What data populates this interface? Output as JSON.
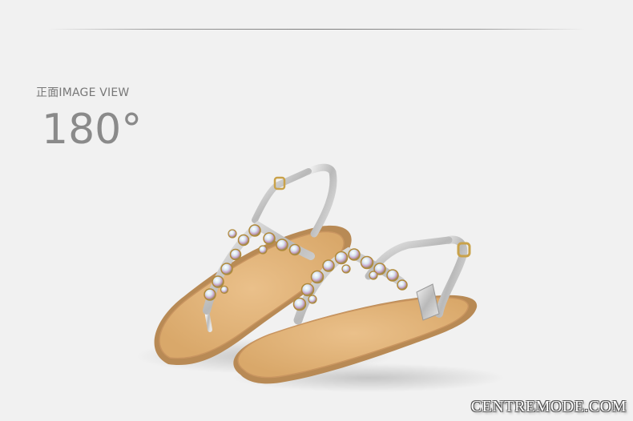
{
  "header": {
    "view_label": "正面IMAGE VIEW",
    "angle": "180°"
  },
  "photo": {
    "subject": "pair of flat thong sandals with jeweled straps",
    "colors": {
      "background": "#f1f1f1",
      "footbed": "#e1b47a",
      "sole_edge": "#b88a55",
      "strap_silver": "#c9c9c9",
      "gem_gold": "#c9a24a"
    }
  },
  "watermark": "CENTREMODE.COM"
}
